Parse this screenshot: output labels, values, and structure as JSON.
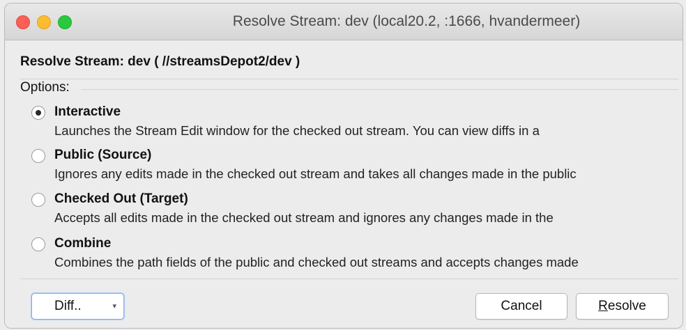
{
  "window": {
    "title": "Resolve Stream: dev (local20.2,  :1666,  hvandermeer)"
  },
  "dialog": {
    "header": "Resolve Stream: dev ( //streamsDepot2/dev )",
    "options_label": "Options:",
    "options": [
      {
        "title": "Interactive",
        "description": "Launches the Stream Edit window for the checked out stream. You can view diffs in a",
        "checked": true
      },
      {
        "title": "Public (Source)",
        "description": "Ignores any edits made in the checked out stream and takes all changes made in the public",
        "checked": false
      },
      {
        "title": "Checked Out (Target)",
        "description": "Accepts all edits made in the checked out stream and ignores any changes made in the",
        "checked": false
      },
      {
        "title": "Combine",
        "description": "Combines the path fields of the public and checked out streams and accepts changes made",
        "checked": false
      }
    ]
  },
  "buttons": {
    "diff_label": "Diff..",
    "diff_caret": "▾",
    "cancel_label": "Cancel",
    "resolve_first": "R",
    "resolve_rest": "esolve"
  },
  "colors": {
    "close": "#fc5f57",
    "minimize": "#fdbc2f",
    "maximize": "#29c83f",
    "focus_ring": "#8db2ea"
  }
}
